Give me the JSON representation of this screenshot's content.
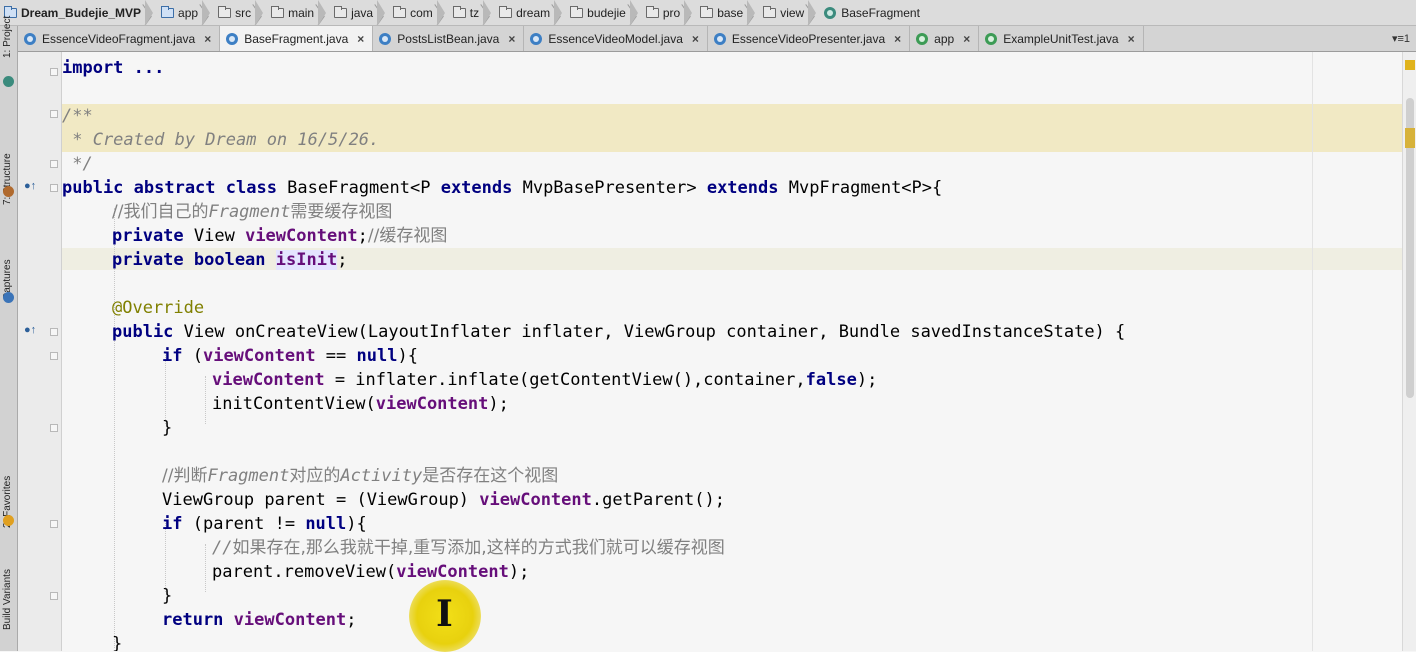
{
  "breadcrumb": [
    "Dream_Budejie_MVP",
    "app",
    "src",
    "main",
    "java",
    "com",
    "tz",
    "dream",
    "budejie",
    "pro",
    "base",
    "view",
    "BaseFragment"
  ],
  "tabs": [
    {
      "label": "EssenceVideoFragment.java",
      "close": "×"
    },
    {
      "label": "BaseFragment.java",
      "close": "×"
    },
    {
      "label": "PostsListBean.java",
      "close": "×"
    },
    {
      "label": "EssenceVideoModel.java",
      "close": "×"
    },
    {
      "label": "EssenceVideoPresenter.java",
      "close": "×"
    },
    {
      "label": "app",
      "close": "×"
    },
    {
      "label": "ExampleUnitTest.java",
      "close": "×"
    }
  ],
  "tab_overflow": "▾≡1",
  "tool_windows": [
    "1: Project",
    "7: Structure",
    "Captures",
    "2: Favorites",
    "Build Variants"
  ],
  "code": {
    "l1": "import ...",
    "l3": "/**",
    "l4": " * Created by Dream on 16/5/26.",
    "l5": " */",
    "l6_kw": "public abstract class",
    "l6_a": " BaseFragment<P ",
    "l6_ext1": "extends",
    "l6_b": " MvpBasePresenter> ",
    "l6_ext2": "extends",
    "l6_c": " MvpFragment<P>{",
    "l7_cm1": "//我们自己的",
    "l7_cm2": "Fragment",
    "l7_cm3": "需要缓存视图",
    "l8_kw": "private",
    "l8_type": " View ",
    "l8_fld": "viewContent",
    "l8_end": ";",
    "l8_cm": "//缓存视图",
    "l9_kw": "private boolean",
    "l9_fld": "isInit",
    "l9_end": ";",
    "l11_ann": "@Override",
    "l12_kw": "public",
    "l12_rest": " View onCreateView(LayoutInflater inflater, ViewGroup container, Bundle savedInstanceState) {",
    "l13_kw": "if",
    "l13_a": " (",
    "l13_fld": "viewContent",
    "l13_b": " == ",
    "l13_null": "null",
    "l13_c": "){",
    "l14_fld": "viewContent",
    "l14_a": " = inflater.inflate(getContentView(),container,",
    "l14_false": "false",
    "l14_b": ");",
    "l15_a": "initContentView(",
    "l15_fld": "viewContent",
    "l15_b": ");",
    "l16": "}",
    "l18_cm1": "//判断",
    "l18_cm2": "Fragment",
    "l18_cm3": "对应的",
    "l18_cm4": "Activity",
    "l18_cm5": "是否存在这个视图",
    "l19_a": "ViewGroup parent = (ViewGroup) ",
    "l19_fld": "viewContent",
    "l19_b": ".getParent();",
    "l20_kw": "if",
    "l20_a": " (parent != ",
    "l20_null": "null",
    "l20_b": "){",
    "l21_cm1": "//",
    "l21_cm2": "如果存在,那么我就干掉,重写添加,这样的方式我们就可以缓存视图",
    "l22_a": "parent.removeView(",
    "l22_fld": "viewContent",
    "l22_b": ");",
    "l23": "}",
    "l24_kw": "return",
    "l24_fld": "viewContent",
    "l24_end": ";",
    "l25": "}"
  },
  "cursor_glyph": "I",
  "colors": {
    "keyword": "#000080",
    "field": "#660e7a",
    "comment": "#808080",
    "annotation": "#808000",
    "doc_highlight": "#f1e9c4"
  }
}
